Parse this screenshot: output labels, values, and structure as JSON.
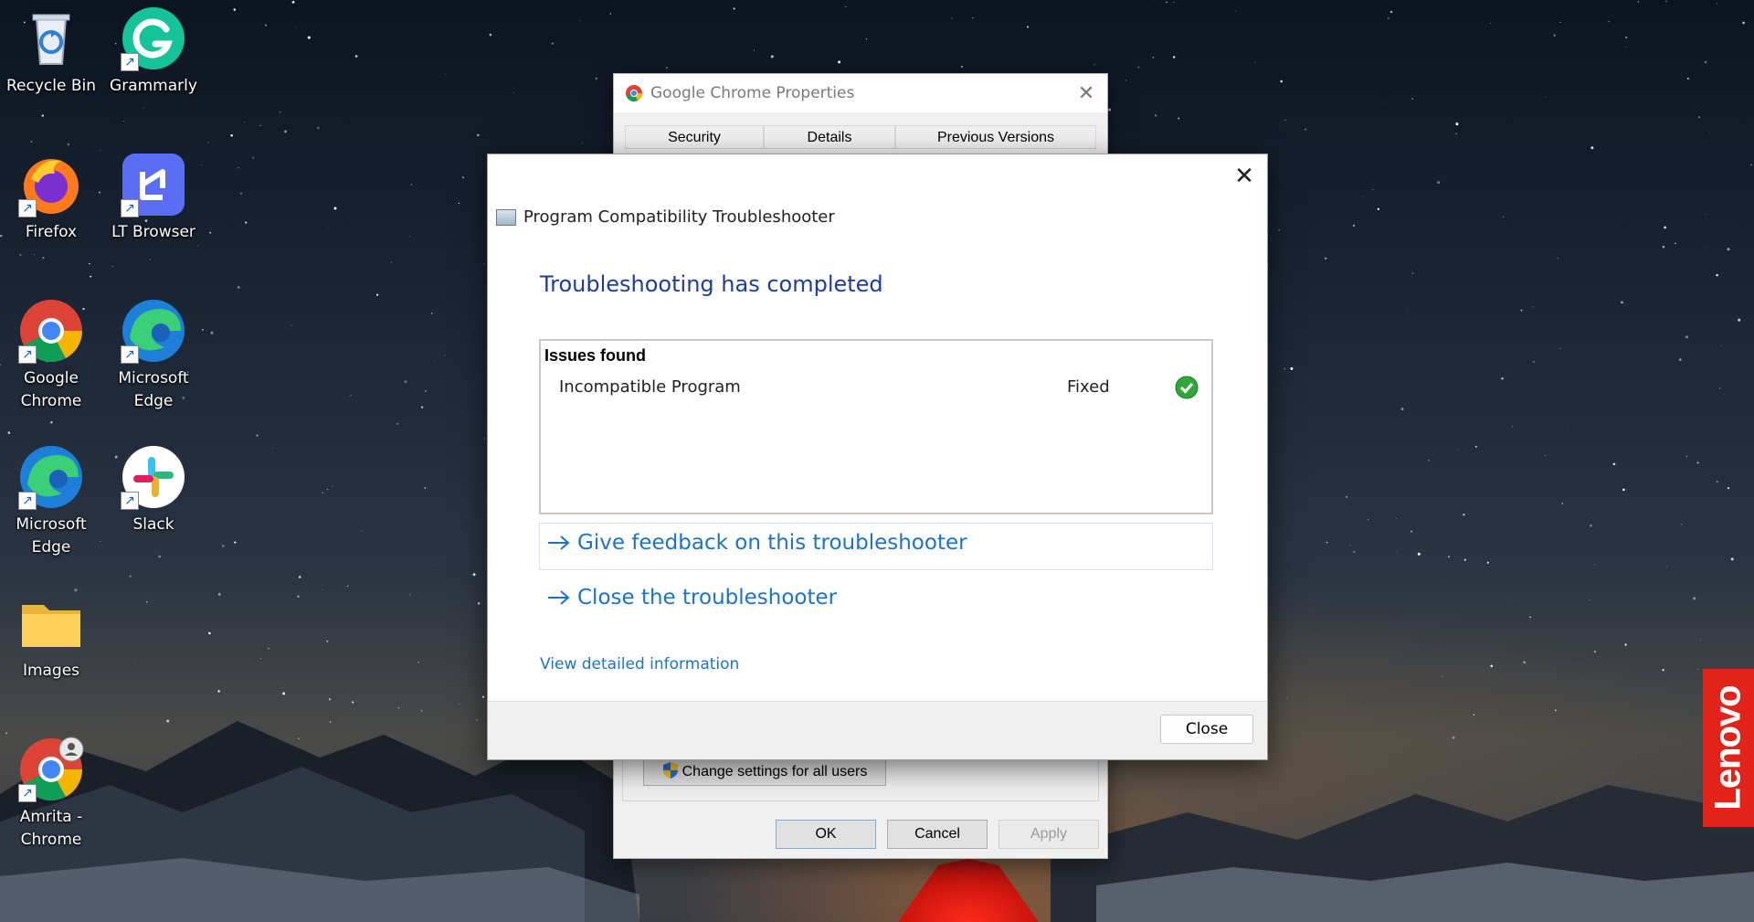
{
  "desktop": {
    "icons": [
      {
        "label": "Recycle Bin",
        "icon": "recycle-bin-icon",
        "shortcut": false
      },
      {
        "label": "Grammarly",
        "icon": "grammarly-icon",
        "shortcut": true
      },
      {
        "label": "Firefox",
        "icon": "firefox-icon",
        "shortcut": true
      },
      {
        "label": "LT Browser",
        "icon": "lt-browser-icon",
        "shortcut": true
      },
      {
        "label": "Google Chrome",
        "icon": "chrome-icon",
        "shortcut": true
      },
      {
        "label": "Microsoft Edge",
        "icon": "edge-icon",
        "shortcut": true
      },
      {
        "label": "Microsoft Edge",
        "icon": "edge-icon",
        "shortcut": true
      },
      {
        "label": "Slack",
        "icon": "slack-icon",
        "shortcut": true
      },
      {
        "label": "Images",
        "icon": "folder-icon",
        "shortcut": false
      },
      {
        "label": "Amrita - Chrome",
        "icon": "chrome-profile-icon",
        "shortcut": true
      }
    ],
    "brand": "Lenovo"
  },
  "properties_window": {
    "title": "Google Chrome Properties",
    "tabs": [
      "Security",
      "Details",
      "Previous Versions"
    ],
    "change_settings_label": "Change settings for all users",
    "ok_label": "OK",
    "cancel_label": "Cancel",
    "apply_label": "Apply"
  },
  "troubleshooter": {
    "app_title": "Program Compatibility Troubleshooter",
    "heading": "Troubleshooting has completed",
    "issues_header": "Issues found",
    "issues": [
      {
        "name": "Incompatible Program",
        "status": "Fixed",
        "icon": "green-check-icon"
      }
    ],
    "feedback_link": "Give feedback on this troubleshooter",
    "close_link": "Close the troubleshooter",
    "details_link": "View detailed information",
    "close_button": "Close"
  },
  "colors": {
    "heading": "#1f3d99",
    "link": "#1a73c9",
    "lenovo_red": "#e2231a",
    "check_green": "#2fa83a"
  }
}
